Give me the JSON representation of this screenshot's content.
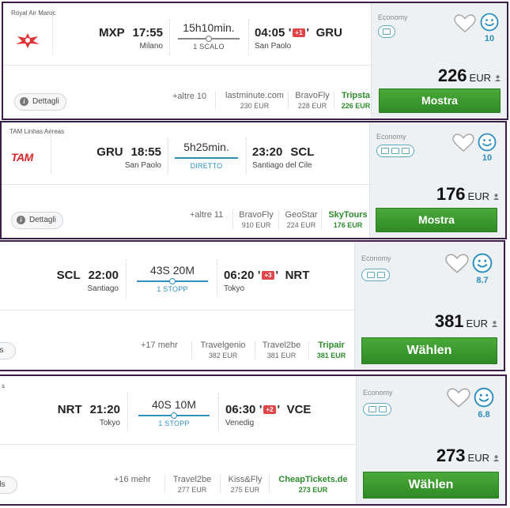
{
  "cards": [
    {
      "airline": "Royal Air Maroc",
      "dep_code": "MXP",
      "dep_time": "17:55",
      "dep_city": "Milano",
      "duration": "15h10min.",
      "stops": "1 SCALO",
      "arr_time": "04:05",
      "day_offset": "+1",
      "arr_code": "GRU",
      "arr_city": "San Paolo",
      "details": "Dettagli",
      "more": "+altre 10",
      "providers": [
        {
          "name": "lastminute.com",
          "price": "230 EUR"
        },
        {
          "name": "BravoFly",
          "price": "228 EUR"
        },
        {
          "name": "Tripsta",
          "price": "226 EUR"
        }
      ],
      "cabin": "Economy",
      "score": "10",
      "price": "226",
      "currency": "EUR",
      "button": "Mostra"
    },
    {
      "airline": "TAM Linhas Aereas",
      "logo_text": "TAM",
      "dep_code": "GRU",
      "dep_time": "18:55",
      "dep_city": "San Paolo",
      "duration": "5h25min.",
      "stops": "DIRETTO",
      "arr_time": "23:20",
      "day_offset": "",
      "arr_code": "SCL",
      "arr_city": "Santiago del Cile",
      "details": "Dettagli",
      "more": "+altre 11",
      "providers": [
        {
          "name": "BravoFly",
          "price": "910 EUR"
        },
        {
          "name": "GeoStar",
          "price": "224 EUR"
        },
        {
          "name": "SkyTours",
          "price": "176 EUR"
        }
      ],
      "cabin": "Economy",
      "score": "10",
      "price": "176",
      "currency": "EUR",
      "button": "Mostra"
    },
    {
      "airline": "",
      "dep_code": "SCL",
      "dep_time": "22:00",
      "dep_city": "Santiago",
      "duration": "43S 20M",
      "stops": "1 STOPP",
      "arr_time": "06:20",
      "day_offset": "+3",
      "arr_code": "NRT",
      "arr_city": "Tokyo",
      "details": "ils",
      "more": "+17 mehr",
      "providers": [
        {
          "name": "Travelgenio",
          "price": "382 EUR"
        },
        {
          "name": "Travel2be",
          "price": "381 EUR"
        },
        {
          "name": "Tripair",
          "price": "381 EUR"
        }
      ],
      "cabin": "Economy",
      "score": "8.7",
      "price": "381",
      "currency": "EUR",
      "button": "Wählen"
    },
    {
      "airline": "s",
      "dep_code": "NRT",
      "dep_time": "21:20",
      "dep_city": "Tokyo",
      "duration": "40S 10M",
      "stops": "1 STOPP",
      "arr_time": "06:30",
      "day_offset": "+2",
      "arr_code": "VCE",
      "arr_city": "Venedig",
      "details": "ils",
      "more": "+16 mehr",
      "providers": [
        {
          "name": "Travel2be",
          "price": "277 EUR"
        },
        {
          "name": "Kiss&Fly",
          "price": "275 EUR"
        },
        {
          "name": "CheapTickets.de",
          "price": "273 EUR"
        }
      ],
      "cabin": "Economy",
      "score": "6.8",
      "price": "273",
      "currency": "EUR",
      "button": "Wählen"
    }
  ],
  "icons": {
    "favorite": "heart-icon",
    "rating": "smiley-icon",
    "info": "info-icon",
    "user": "user-icon",
    "amenity": "seat-amenity-icon"
  },
  "colors": {
    "border": "#3a1e47",
    "button": "#3d9a2f",
    "best_provider": "#2e8b2e",
    "accent": "#2d8fbd",
    "badge": "#e0454a"
  }
}
